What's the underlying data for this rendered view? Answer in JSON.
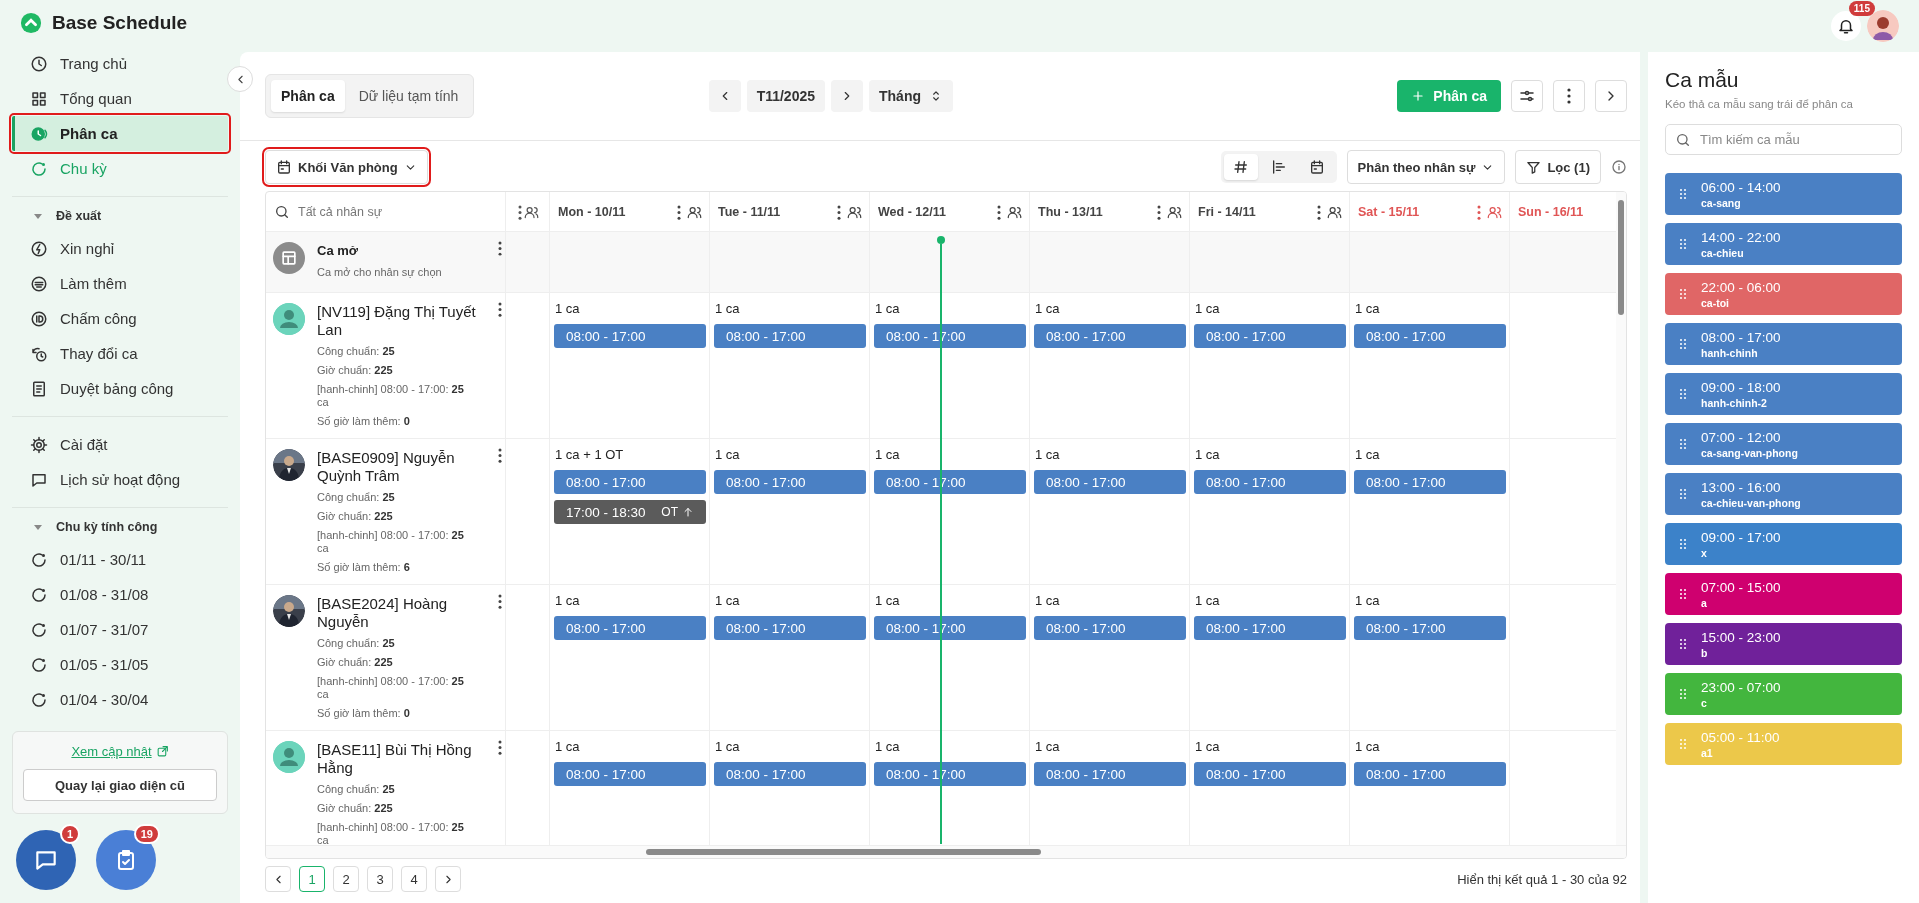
{
  "header": {
    "notifications": "115"
  },
  "sidebar": {
    "brand": "Base Schedule",
    "nav": [
      {
        "label": "Trang chủ",
        "selected": false,
        "highlighted": false
      },
      {
        "label": "Tổng quan",
        "selected": false,
        "highlighted": false
      },
      {
        "label": "Phân ca",
        "selected": true,
        "highlighted": true,
        "children": [
          {
            "label": "Chu kỳ",
            "selected": true
          }
        ]
      }
    ],
    "sections": [
      {
        "title": "Đề xuất",
        "expanded": true,
        "items": [
          {
            "label": "Xin nghỉ",
            "selected": false
          },
          {
            "label": "Làm thêm",
            "selected": false
          },
          {
            "label": "Chấm công",
            "selected": false
          },
          {
            "label": "Thay đổi ca",
            "selected": false
          },
          {
            "label": "Duyệt bảng công",
            "selected": false
          }
        ]
      },
      {
        "items": [
          {
            "label": "Cài đặt",
            "selected": false
          },
          {
            "label": "Lịch sử hoạt động",
            "selected": false
          }
        ]
      },
      {
        "title": "Chu kỳ tính công",
        "expanded": true,
        "items": [
          {
            "label": "01/11 - 30/11",
            "selected": false
          },
          {
            "label": "01/08 - 31/08",
            "selected": false
          },
          {
            "label": "01/07 - 31/07",
            "selected": false
          },
          {
            "label": "01/05 - 31/05",
            "selected": false
          },
          {
            "label": "01/04 - 30/04",
            "selected": false
          }
        ]
      }
    ],
    "update_link": "Xem cập nhật",
    "legacy_button": "Quay lại giao diện cũ",
    "fabs": [
      {
        "kind": "chat",
        "badge": "1"
      },
      {
        "kind": "tasks",
        "badge": "19"
      }
    ]
  },
  "toolbar": {
    "tabs": [
      {
        "label": "Phân ca",
        "selected": true
      },
      {
        "label": "Dữ liệu tạm tính",
        "selected": false
      }
    ],
    "period": "T11/2025",
    "range": "Tháng",
    "add_button": "Phân ca"
  },
  "filters": {
    "department": {
      "label": "Khối Văn phòng",
      "highlighted": true
    },
    "views": [
      {
        "selected": true
      },
      {
        "selected": false
      },
      {
        "selected": false
      }
    ],
    "group_by": "Phân theo nhân sự",
    "filter_button": "Lọc (1)"
  },
  "schedule": {
    "search_placeholder": "Tất cả nhân sự",
    "days": [
      {
        "label": "Mon - 10/11",
        "weekend": false
      },
      {
        "label": "Tue - 11/11",
        "weekend": false
      },
      {
        "label": "Wed - 12/11",
        "weekend": false
      },
      {
        "label": "Thu - 13/11",
        "weekend": false
      },
      {
        "label": "Fri - 14/11",
        "weekend": false
      },
      {
        "label": "Sat - 15/11",
        "weekend": true
      },
      {
        "label": "Sun - 16/11",
        "weekend": true
      }
    ],
    "open_shift": {
      "title": "Ca mở",
      "subtitle": "Ca mở cho nhân sự chọn"
    },
    "employees": [
      {
        "name": "[NV119] Đặng Thị Tuyết Lan",
        "kind": "default",
        "details": [
          "Công chuẩn: **25**",
          "Giờ chuẩn: **225**",
          "[hanh-chinh] 08:00 - 17:00: **25** ca",
          "Số giờ làm thêm: **0**"
        ],
        "cells": [
          {
            "summary": "1 ca",
            "shifts": [
              {
                "time": "08:00 - 17:00",
                "kind": "regular"
              }
            ]
          },
          {
            "summary": "1 ca",
            "shifts": [
              {
                "time": "08:00 - 17:00",
                "kind": "regular"
              }
            ]
          },
          {
            "summary": "1 ca",
            "shifts": [
              {
                "time": "08:00 - 17:00",
                "kind": "regular"
              }
            ]
          },
          {
            "summary": "1 ca",
            "shifts": [
              {
                "time": "08:00 - 17:00",
                "kind": "regular"
              }
            ]
          },
          {
            "summary": "1 ca",
            "shifts": [
              {
                "time": "08:00 - 17:00",
                "kind": "regular"
              }
            ]
          },
          {
            "summary": "1 ca",
            "shifts": [
              {
                "time": "08:00 - 17:00",
                "kind": "regular"
              }
            ]
          }
        ]
      },
      {
        "name": "[BASE0909] Nguyễn Quỳnh Trâm",
        "kind": "picture",
        "details": [
          "Công chuẩn: **25**",
          "Giờ chuẩn: **225**",
          "[hanh-chinh] 08:00 - 17:00: **25** ca",
          "Số giờ làm thêm: **6**"
        ],
        "cells": [
          {
            "summary": "1 ca + 1 OT",
            "shifts": [
              {
                "time": "08:00 - 17:00",
                "kind": "regular"
              },
              {
                "time": "17:00 - 18:30",
                "kind": "ot",
                "tag": "OT"
              }
            ]
          },
          {
            "summary": "1 ca",
            "shifts": [
              {
                "time": "08:00 - 17:00",
                "kind": "regular"
              }
            ]
          },
          {
            "summary": "1 ca",
            "shifts": [
              {
                "time": "08:00 - 17:00",
                "kind": "regular"
              }
            ]
          },
          {
            "summary": "1 ca",
            "shifts": [
              {
                "time": "08:00 - 17:00",
                "kind": "regular"
              }
            ]
          },
          {
            "summary": "1 ca",
            "shifts": [
              {
                "time": "08:00 - 17:00",
                "kind": "regular"
              }
            ]
          },
          {
            "summary": "1 ca",
            "shifts": [
              {
                "time": "08:00 - 17:00",
                "kind": "regular"
              }
            ]
          }
        ]
      },
      {
        "name": "[BASE2024] Hoàng Nguyễn",
        "kind": "picture",
        "details": [
          "Công chuẩn: **25**",
          "Giờ chuẩn: **225**",
          "[hanh-chinh] 08:00 - 17:00: **25** ca",
          "Số giờ làm thêm: **0**"
        ],
        "cells": [
          {
            "summary": "1 ca",
            "shifts": [
              {
                "time": "08:00 - 17:00",
                "kind": "regular"
              }
            ]
          },
          {
            "summary": "1 ca",
            "shifts": [
              {
                "time": "08:00 - 17:00",
                "kind": "regular"
              }
            ]
          },
          {
            "summary": "1 ca",
            "shifts": [
              {
                "time": "08:00 - 17:00",
                "kind": "regular"
              }
            ]
          },
          {
            "summary": "1 ca",
            "shifts": [
              {
                "time": "08:00 - 17:00",
                "kind": "regular"
              }
            ]
          },
          {
            "summary": "1 ca",
            "shifts": [
              {
                "time": "08:00 - 17:00",
                "kind": "regular"
              }
            ]
          },
          {
            "summary": "1 ca",
            "shifts": [
              {
                "time": "08:00 - 17:00",
                "kind": "regular"
              }
            ]
          }
        ]
      },
      {
        "name": "[BASE11] Bùi Thị Hồng Hằng",
        "kind": "default",
        "details": [
          "Công chuẩn: **25**",
          "Giờ chuẩn: **225**",
          "[hanh-chinh] 08:00 - 17:00: **25** ca"
        ],
        "cells": [
          {
            "summary": "1 ca",
            "shifts": [
              {
                "time": "08:00 - 17:00",
                "kind": "regular"
              }
            ]
          },
          {
            "summary": "1 ca",
            "shifts": [
              {
                "time": "08:00 - 17:00",
                "kind": "regular"
              }
            ]
          },
          {
            "summary": "1 ca",
            "shifts": [
              {
                "time": "08:00 - 17:00",
                "kind": "regular"
              }
            ]
          },
          {
            "summary": "1 ca",
            "shifts": [
              {
                "time": "08:00 - 17:00",
                "kind": "regular"
              }
            ]
          },
          {
            "summary": "1 ca",
            "shifts": [
              {
                "time": "08:00 - 17:00",
                "kind": "regular"
              }
            ]
          },
          {
            "summary": "1 ca",
            "shifts": [
              {
                "time": "08:00 - 17:00",
                "kind": "regular"
              }
            ]
          }
        ]
      }
    ]
  },
  "pagination": {
    "pages": [
      {
        "label": "1",
        "selected": true
      },
      {
        "label": "2",
        "selected": false
      },
      {
        "label": "3",
        "selected": false
      },
      {
        "label": "4",
        "selected": false
      }
    ],
    "summary": "Hiển thị kết quả 1 - 30 của 92"
  },
  "templates_panel": {
    "title": "Ca mẫu",
    "subtitle": "Kéo thả ca mẫu sang trái để phân ca",
    "search_placeholder": "Tìm kiếm ca mẫu",
    "templates": [
      {
        "time": "06:00 - 14:00",
        "code": "ca-sang",
        "color": "#4a80c4"
      },
      {
        "time": "14:00 - 22:00",
        "code": "ca-chieu",
        "color": "#4a80c4"
      },
      {
        "time": "22:00 - 06:00",
        "code": "ca-toi",
        "color": "#e06666"
      },
      {
        "time": "08:00 - 17:00",
        "code": "hanh-chinh",
        "color": "#4a80c4"
      },
      {
        "time": "09:00 - 18:00",
        "code": "hanh-chinh-2",
        "color": "#4a80c4"
      },
      {
        "time": "07:00 - 12:00",
        "code": "ca-sang-van-phong",
        "color": "#4a80c4"
      },
      {
        "time": "13:00 - 16:00",
        "code": "ca-chieu-van-phong",
        "color": "#4a80c4"
      },
      {
        "time": "09:00 - 17:00",
        "code": "x",
        "color": "#3c82c9"
      },
      {
        "time": "07:00 - 15:00",
        "code": "a",
        "color": "#cf006f"
      },
      {
        "time": "15:00 - 23:00",
        "code": "b",
        "color": "#70219a"
      },
      {
        "time": "23:00 - 07:00",
        "code": "c",
        "color": "#43b63e"
      },
      {
        "time": "05:00 - 11:00",
        "code": "a1",
        "color": "#ecc84a"
      }
    ]
  }
}
